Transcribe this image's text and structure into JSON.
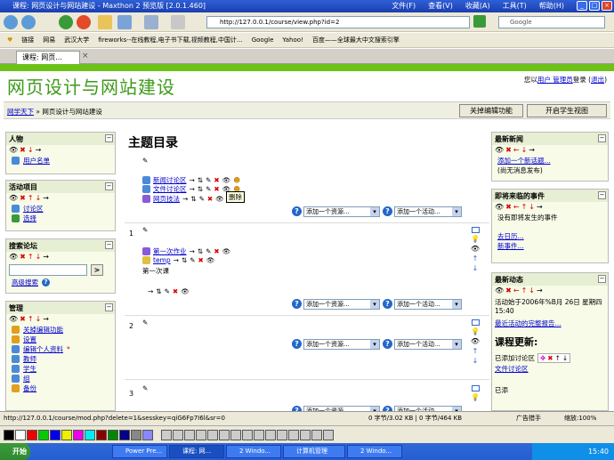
{
  "window": {
    "title": "课程: 网页设计与网站建设 - Maxthon 2 预览版 [2.0.1.460]"
  },
  "menu": [
    "文件(F)",
    "查看(V)",
    "收藏(A)",
    "工具(T)",
    "帮助(H)"
  ],
  "address": {
    "url": "http://127.0.0.1/course/view.php?id=2"
  },
  "search": {
    "placeholder": "Google"
  },
  "favorites": [
    "链接",
    "网易",
    "武汉大学",
    "fireworks--在线教程,电子书下载,视频教程,中国计...",
    "Google",
    "Yahoo!",
    "百度——全球最大中文搜索引擎"
  ],
  "tab": {
    "label": "课程: 网页..."
  },
  "site": {
    "title": "网页设计与网站建设",
    "login_prefix": "您以",
    "login_user": "用户 管理员",
    "login_mid": "登录 (",
    "logout": "退出",
    "login_suffix": ")"
  },
  "breadcrumb": {
    "home": "网学天下",
    "sep": "»",
    "current": "网页设计与网站建设"
  },
  "buttons": {
    "edit_off": "关掉编辑功能",
    "student_view": "开启学生视图"
  },
  "blocks": {
    "people": {
      "title": "人物",
      "items": [
        "用户名单"
      ]
    },
    "activities": {
      "title": "活动项目",
      "items": [
        "讨论区",
        "选择"
      ]
    },
    "search": {
      "title": "搜索论坛",
      "go": ">",
      "advanced": "高级搜索"
    },
    "admin": {
      "title": "管理",
      "items": [
        "关掉编辑功能",
        "设置",
        "编辑个人资料",
        "教师",
        "学生",
        "组",
        "备份"
      ]
    },
    "news": {
      "title": "最新新闻",
      "add": "添加一个新话题...",
      "none": "(尚无消息发布)"
    },
    "events": {
      "title": "即将来临的事件",
      "none": "没有即将发生的事件",
      "calendar": "去日历...",
      "new_event": "新事件..."
    },
    "recent": {
      "title": "最新动态",
      "since": "活动始于2006年%B月 26日 星期四 15:40",
      "full": "最近活动的完整报告...",
      "updates": "课程更新:",
      "added": "已添加讨论区",
      "forum": "文件讨论区",
      "other": "已添"
    }
  },
  "main": {
    "title": "主题目录",
    "section0": [
      "新闻讨论区",
      "文件讨论区",
      "网页技法"
    ],
    "tooltip": "删除",
    "section1": {
      "num": "1",
      "items": [
        "第一次作业",
        "temp"
      ],
      "text": "第一次课"
    },
    "section2": {
      "num": "2"
    },
    "section3": {
      "num": "3"
    },
    "add_resource": "添加一个资源...",
    "add_activity": "添加一个活动..."
  },
  "status": {
    "url": "http://127.0.0.1/course/mod.php?delete=1&sesskey=qiG6Fp7I6l&sr=0",
    "sizes": "0 字节/3.02 KB | 0 字节/464 KB",
    "adblock": "广告猎手",
    "zoom": "缩放:100%"
  },
  "taskbar": {
    "start": "开始",
    "tasks": [
      "Power Pre...",
      "课程: 网...",
      "2 Windo...",
      "计算机管理",
      "2 Windo..."
    ],
    "clock": "15:40"
  },
  "colors": {
    "accent": "#6dc218",
    "title": "#3d9a1a",
    "link": "#0000cc"
  }
}
